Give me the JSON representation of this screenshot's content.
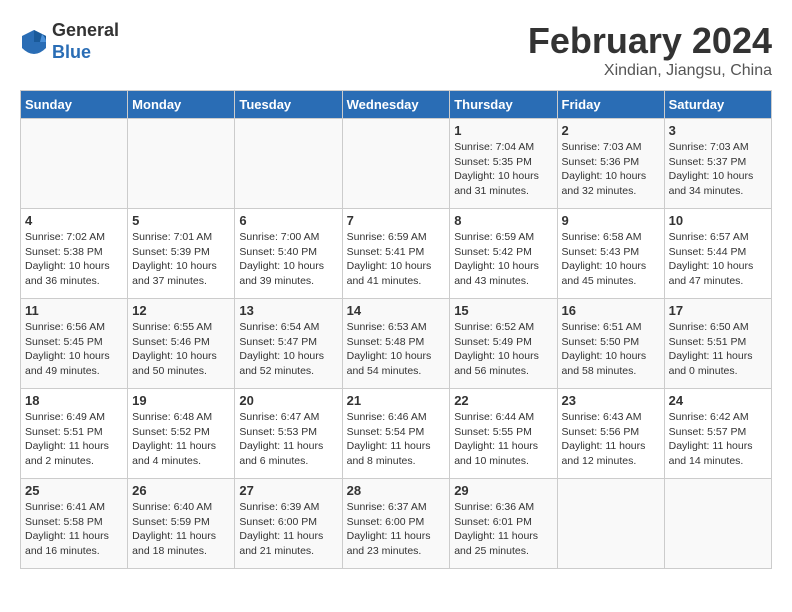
{
  "header": {
    "logo_line1": "General",
    "logo_line2": "Blue",
    "month": "February 2024",
    "location": "Xindian, Jiangsu, China"
  },
  "days_of_week": [
    "Sunday",
    "Monday",
    "Tuesday",
    "Wednesday",
    "Thursday",
    "Friday",
    "Saturday"
  ],
  "weeks": [
    [
      {
        "day": "",
        "sunrise": "",
        "sunset": "",
        "daylight": ""
      },
      {
        "day": "",
        "sunrise": "",
        "sunset": "",
        "daylight": ""
      },
      {
        "day": "",
        "sunrise": "",
        "sunset": "",
        "daylight": ""
      },
      {
        "day": "",
        "sunrise": "",
        "sunset": "",
        "daylight": ""
      },
      {
        "day": "1",
        "sunrise": "Sunrise: 7:04 AM",
        "sunset": "Sunset: 5:35 PM",
        "daylight": "Daylight: 10 hours and 31 minutes."
      },
      {
        "day": "2",
        "sunrise": "Sunrise: 7:03 AM",
        "sunset": "Sunset: 5:36 PM",
        "daylight": "Daylight: 10 hours and 32 minutes."
      },
      {
        "day": "3",
        "sunrise": "Sunrise: 7:03 AM",
        "sunset": "Sunset: 5:37 PM",
        "daylight": "Daylight: 10 hours and 34 minutes."
      }
    ],
    [
      {
        "day": "4",
        "sunrise": "Sunrise: 7:02 AM",
        "sunset": "Sunset: 5:38 PM",
        "daylight": "Daylight: 10 hours and 36 minutes."
      },
      {
        "day": "5",
        "sunrise": "Sunrise: 7:01 AM",
        "sunset": "Sunset: 5:39 PM",
        "daylight": "Daylight: 10 hours and 37 minutes."
      },
      {
        "day": "6",
        "sunrise": "Sunrise: 7:00 AM",
        "sunset": "Sunset: 5:40 PM",
        "daylight": "Daylight: 10 hours and 39 minutes."
      },
      {
        "day": "7",
        "sunrise": "Sunrise: 6:59 AM",
        "sunset": "Sunset: 5:41 PM",
        "daylight": "Daylight: 10 hours and 41 minutes."
      },
      {
        "day": "8",
        "sunrise": "Sunrise: 6:59 AM",
        "sunset": "Sunset: 5:42 PM",
        "daylight": "Daylight: 10 hours and 43 minutes."
      },
      {
        "day": "9",
        "sunrise": "Sunrise: 6:58 AM",
        "sunset": "Sunset: 5:43 PM",
        "daylight": "Daylight: 10 hours and 45 minutes."
      },
      {
        "day": "10",
        "sunrise": "Sunrise: 6:57 AM",
        "sunset": "Sunset: 5:44 PM",
        "daylight": "Daylight: 10 hours and 47 minutes."
      }
    ],
    [
      {
        "day": "11",
        "sunrise": "Sunrise: 6:56 AM",
        "sunset": "Sunset: 5:45 PM",
        "daylight": "Daylight: 10 hours and 49 minutes."
      },
      {
        "day": "12",
        "sunrise": "Sunrise: 6:55 AM",
        "sunset": "Sunset: 5:46 PM",
        "daylight": "Daylight: 10 hours and 50 minutes."
      },
      {
        "day": "13",
        "sunrise": "Sunrise: 6:54 AM",
        "sunset": "Sunset: 5:47 PM",
        "daylight": "Daylight: 10 hours and 52 minutes."
      },
      {
        "day": "14",
        "sunrise": "Sunrise: 6:53 AM",
        "sunset": "Sunset: 5:48 PM",
        "daylight": "Daylight: 10 hours and 54 minutes."
      },
      {
        "day": "15",
        "sunrise": "Sunrise: 6:52 AM",
        "sunset": "Sunset: 5:49 PM",
        "daylight": "Daylight: 10 hours and 56 minutes."
      },
      {
        "day": "16",
        "sunrise": "Sunrise: 6:51 AM",
        "sunset": "Sunset: 5:50 PM",
        "daylight": "Daylight: 10 hours and 58 minutes."
      },
      {
        "day": "17",
        "sunrise": "Sunrise: 6:50 AM",
        "sunset": "Sunset: 5:51 PM",
        "daylight": "Daylight: 11 hours and 0 minutes."
      }
    ],
    [
      {
        "day": "18",
        "sunrise": "Sunrise: 6:49 AM",
        "sunset": "Sunset: 5:51 PM",
        "daylight": "Daylight: 11 hours and 2 minutes."
      },
      {
        "day": "19",
        "sunrise": "Sunrise: 6:48 AM",
        "sunset": "Sunset: 5:52 PM",
        "daylight": "Daylight: 11 hours and 4 minutes."
      },
      {
        "day": "20",
        "sunrise": "Sunrise: 6:47 AM",
        "sunset": "Sunset: 5:53 PM",
        "daylight": "Daylight: 11 hours and 6 minutes."
      },
      {
        "day": "21",
        "sunrise": "Sunrise: 6:46 AM",
        "sunset": "Sunset: 5:54 PM",
        "daylight": "Daylight: 11 hours and 8 minutes."
      },
      {
        "day": "22",
        "sunrise": "Sunrise: 6:44 AM",
        "sunset": "Sunset: 5:55 PM",
        "daylight": "Daylight: 11 hours and 10 minutes."
      },
      {
        "day": "23",
        "sunrise": "Sunrise: 6:43 AM",
        "sunset": "Sunset: 5:56 PM",
        "daylight": "Daylight: 11 hours and 12 minutes."
      },
      {
        "day": "24",
        "sunrise": "Sunrise: 6:42 AM",
        "sunset": "Sunset: 5:57 PM",
        "daylight": "Daylight: 11 hours and 14 minutes."
      }
    ],
    [
      {
        "day": "25",
        "sunrise": "Sunrise: 6:41 AM",
        "sunset": "Sunset: 5:58 PM",
        "daylight": "Daylight: 11 hours and 16 minutes."
      },
      {
        "day": "26",
        "sunrise": "Sunrise: 6:40 AM",
        "sunset": "Sunset: 5:59 PM",
        "daylight": "Daylight: 11 hours and 18 minutes."
      },
      {
        "day": "27",
        "sunrise": "Sunrise: 6:39 AM",
        "sunset": "Sunset: 6:00 PM",
        "daylight": "Daylight: 11 hours and 21 minutes."
      },
      {
        "day": "28",
        "sunrise": "Sunrise: 6:37 AM",
        "sunset": "Sunset: 6:00 PM",
        "daylight": "Daylight: 11 hours and 23 minutes."
      },
      {
        "day": "29",
        "sunrise": "Sunrise: 6:36 AM",
        "sunset": "Sunset: 6:01 PM",
        "daylight": "Daylight: 11 hours and 25 minutes."
      },
      {
        "day": "",
        "sunrise": "",
        "sunset": "",
        "daylight": ""
      },
      {
        "day": "",
        "sunrise": "",
        "sunset": "",
        "daylight": ""
      }
    ]
  ]
}
